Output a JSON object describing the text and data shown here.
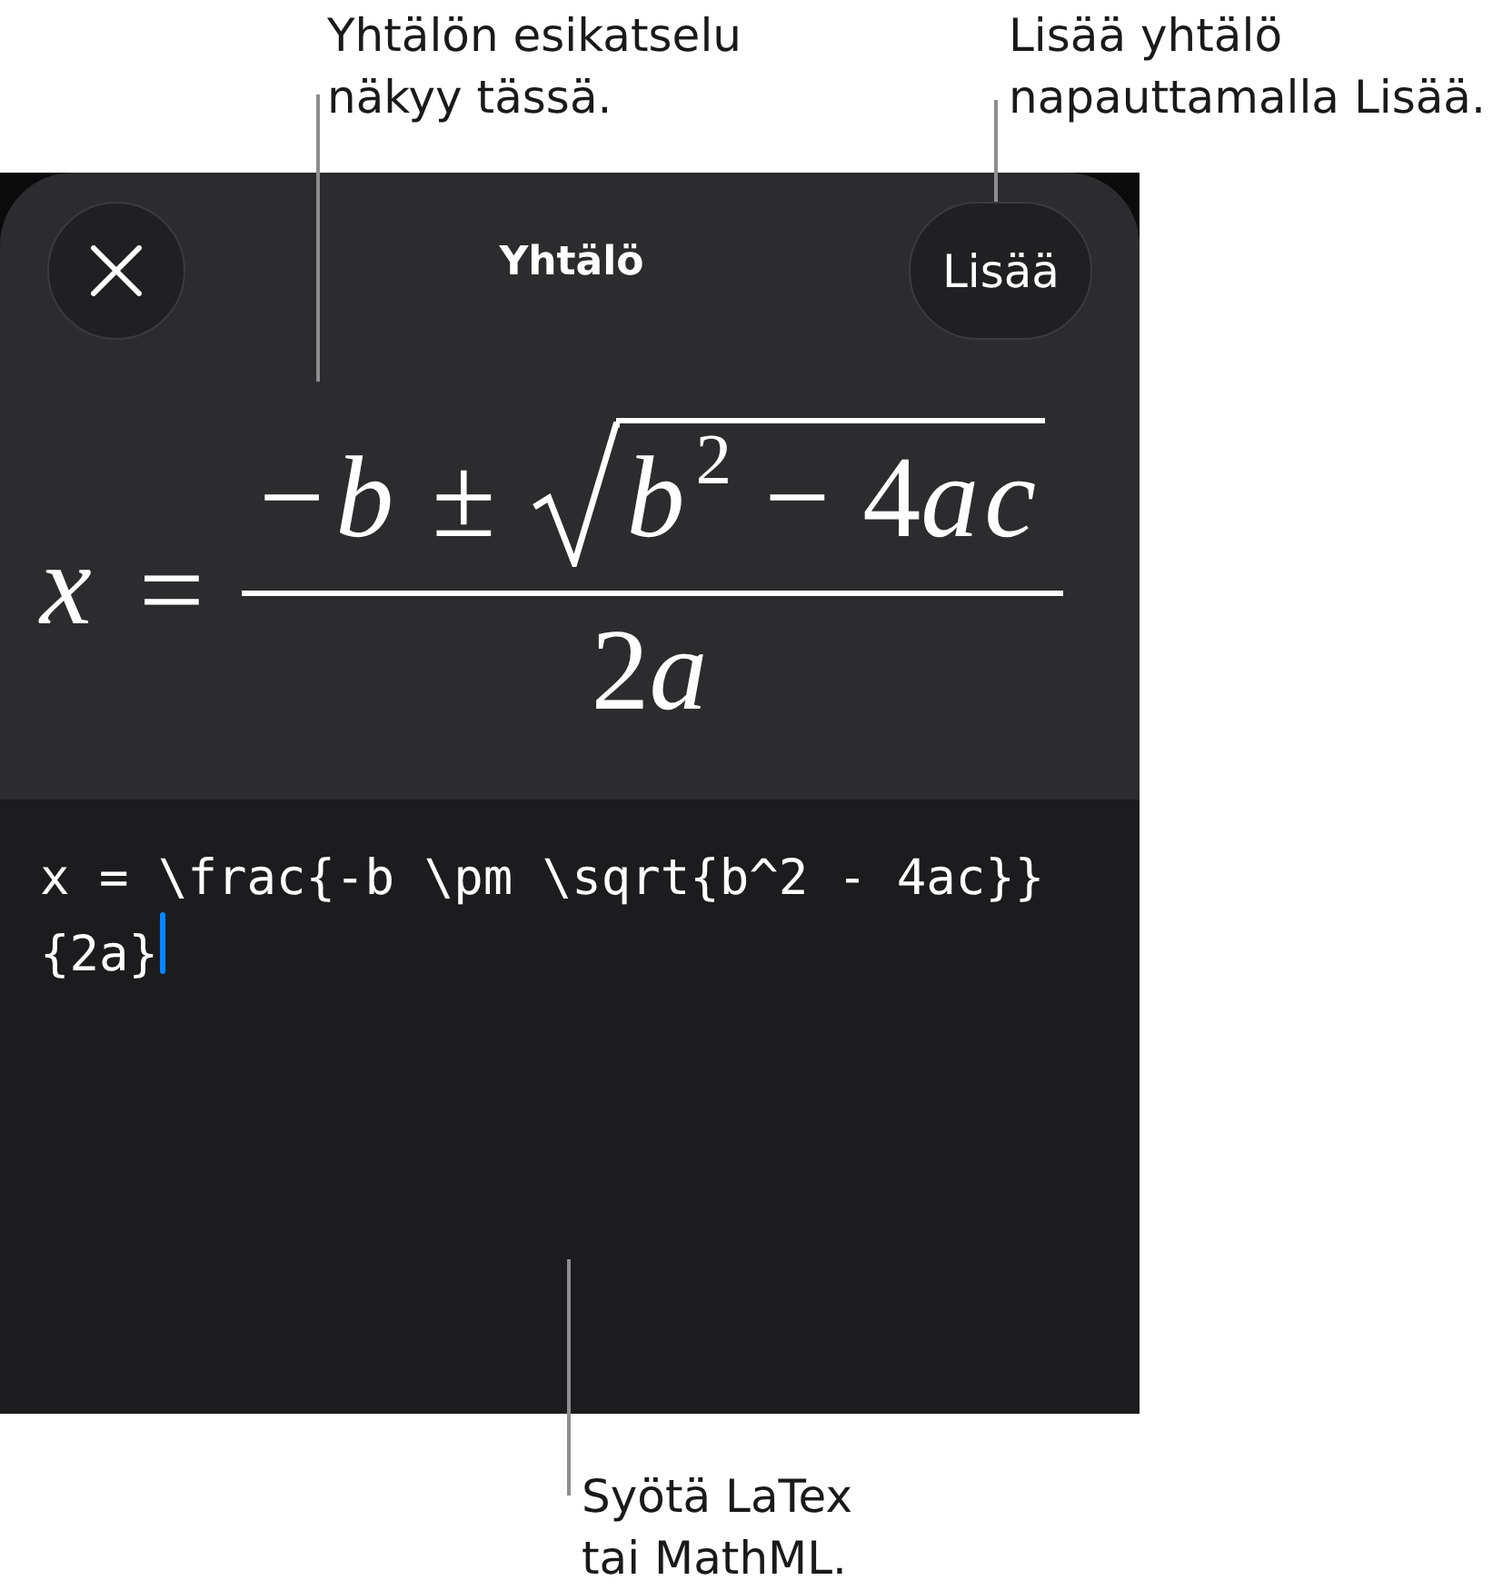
{
  "top_callouts": [
    {
      "lines": [
        "Yhtälön esikatselu",
        "näkyy tässä."
      ]
    },
    {
      "lines": [
        "Lisää yhtälö",
        "napauttamalla Lisää."
      ]
    }
  ],
  "sheet": {
    "title": "Yhtälö",
    "action_button": "Lisää"
  },
  "preview": {
    "equation": {
      "lhs": "x",
      "relation": "=",
      "numerator_prefix": [
        {
          "kind": "sign",
          "text": "−"
        },
        {
          "kind": "var",
          "text": "b"
        },
        {
          "kind": "op",
          "text": "±"
        }
      ],
      "radicand": [
        {
          "kind": "var",
          "text": "b"
        },
        {
          "kind": "sup",
          "text": "2"
        },
        {
          "kind": "op",
          "text": "−"
        },
        {
          "kind": "num",
          "text": "4"
        },
        {
          "kind": "var",
          "text": "ac"
        }
      ],
      "denominator": [
        {
          "kind": "num",
          "text": "2"
        },
        {
          "kind": "var",
          "text": "a"
        }
      ]
    }
  },
  "editor": {
    "value": "x = \\frac{-b \\pm \\sqrt{b^2 - 4ac}}{2a}",
    "focused": true
  },
  "bottom_callouts": [
    {
      "lines": [
        "Syötä LaTex",
        "tai MathML."
      ]
    }
  ]
}
